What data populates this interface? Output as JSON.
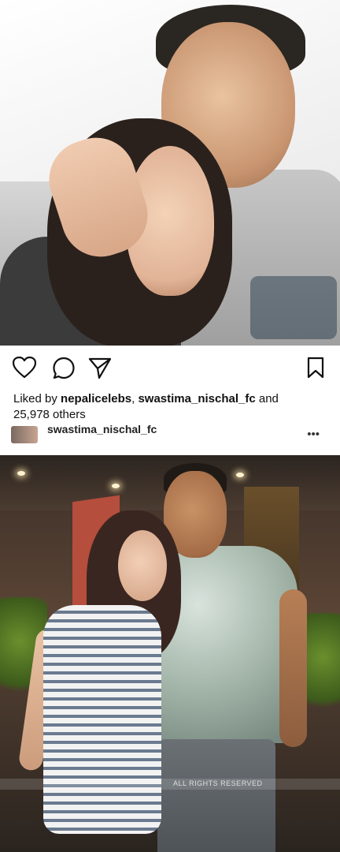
{
  "post": {
    "liked_by_prefix": "Liked by",
    "liked_user_1": "nepalicelebs",
    "separator": ",",
    "liked_user_2": "swastima_nischal_fc",
    "and_text": "and",
    "others": "25,978 others"
  },
  "next_post": {
    "username": "swastima_nischal_fc",
    "more_icon": "•••"
  },
  "icons": {
    "like": "heart-icon",
    "comment": "comment-icon",
    "share": "send-icon",
    "save": "bookmark-icon"
  },
  "watermark": {
    "text": "ALL RIGHTS RESERVED"
  }
}
